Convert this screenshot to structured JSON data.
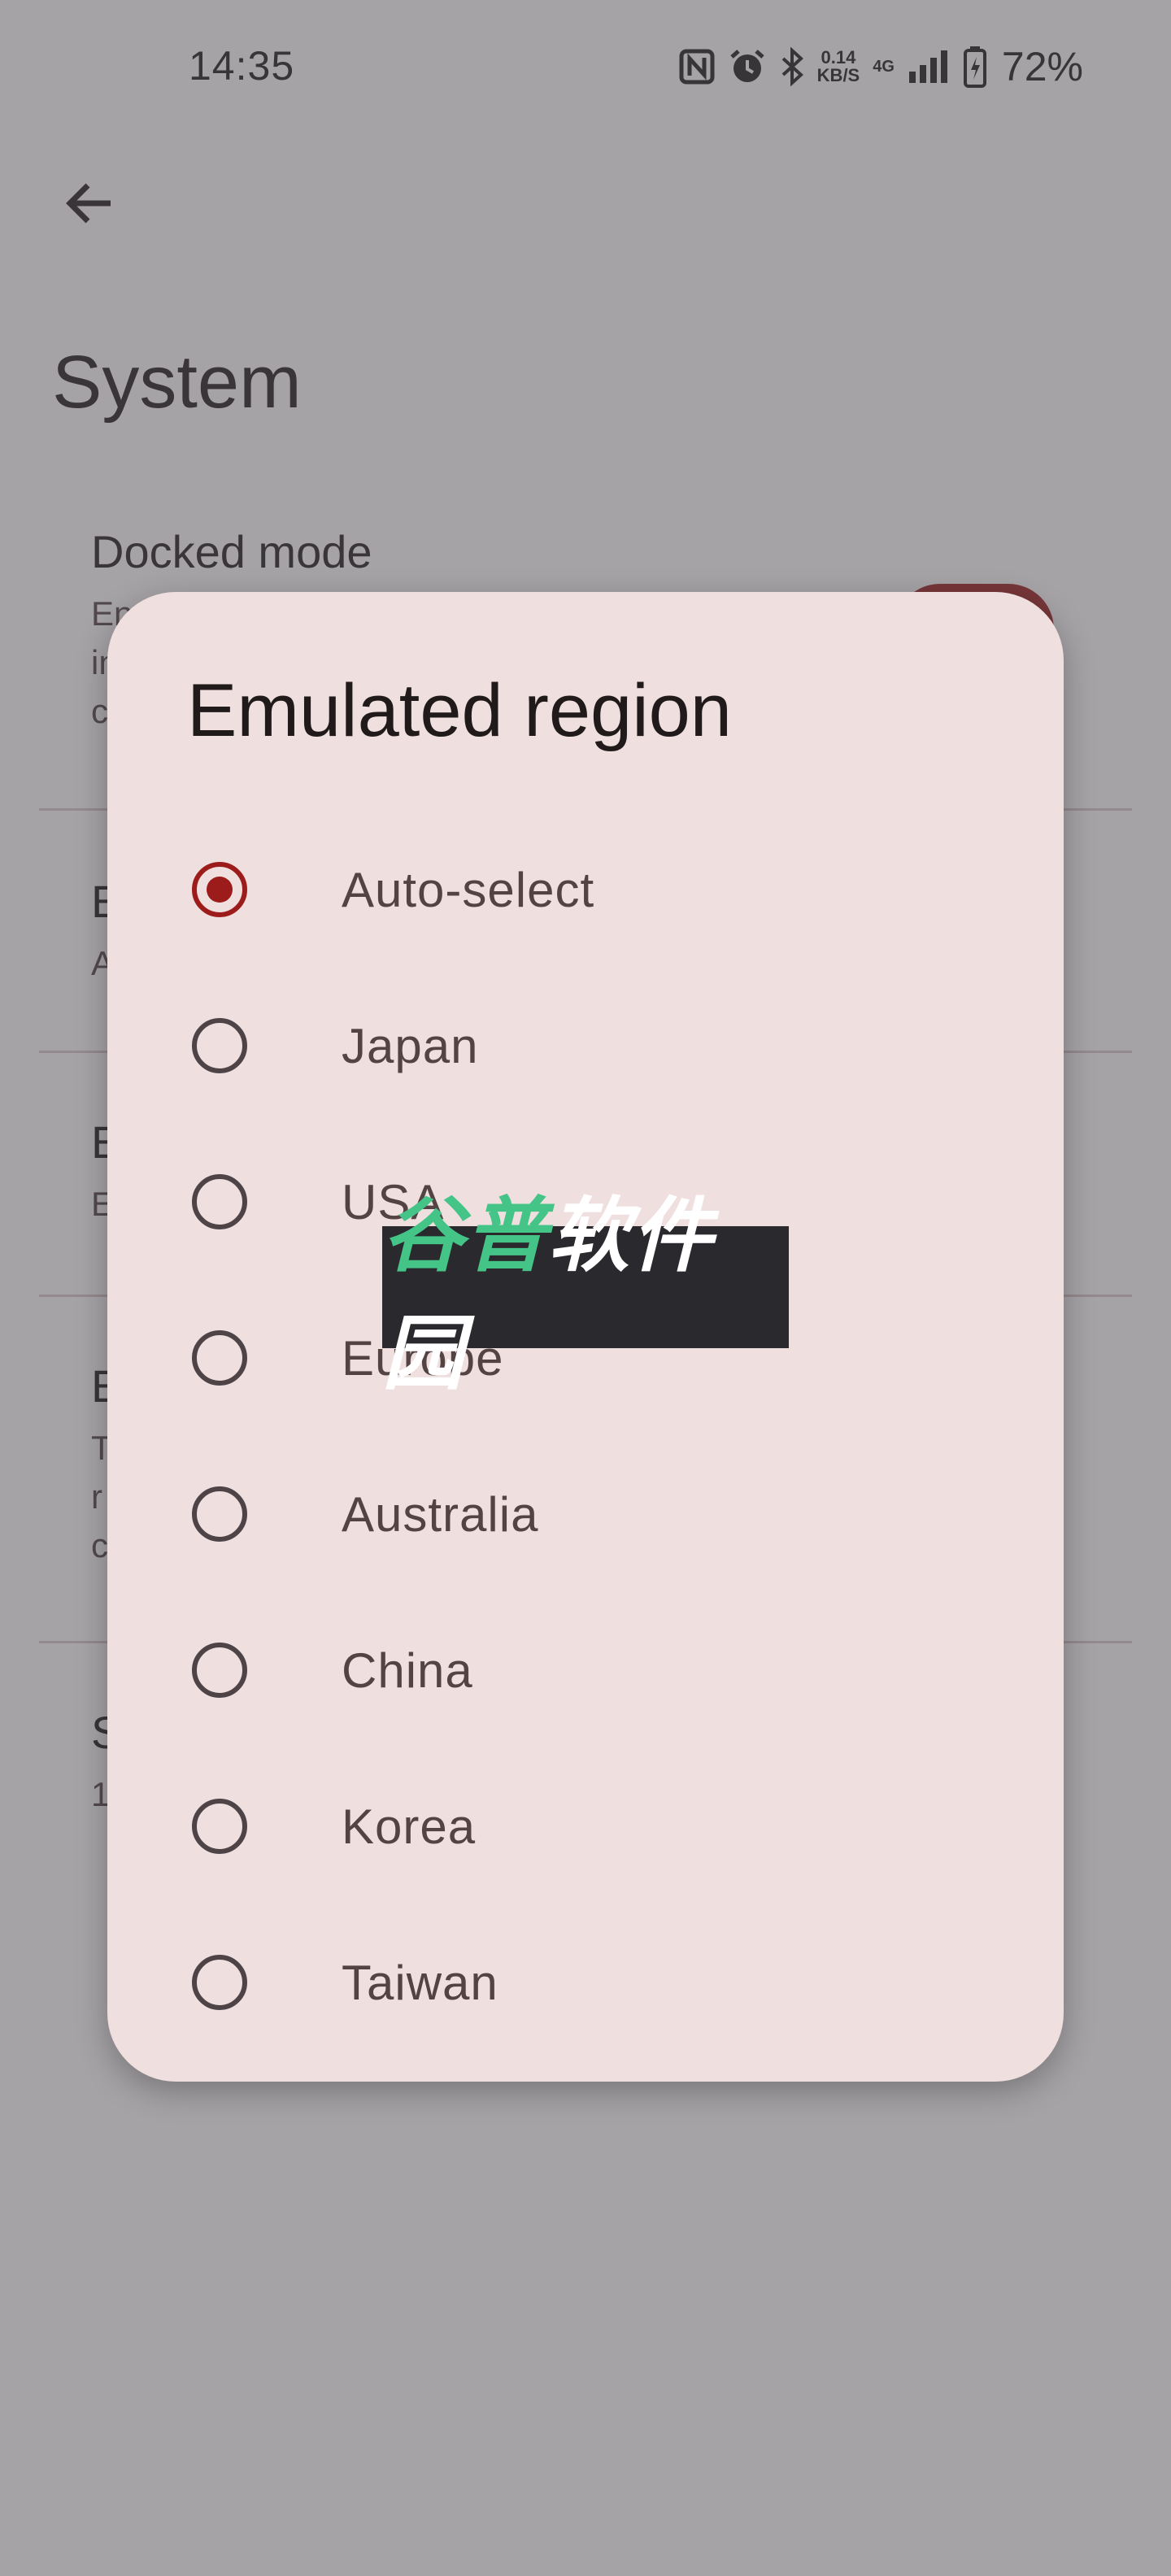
{
  "status_bar": {
    "time": "14:35",
    "net_speed_value": "0.14",
    "net_speed_unit": "KB/S",
    "network": "4G",
    "battery": "72%",
    "icons": [
      "nfc-icon",
      "alarm-icon",
      "bluetooth-icon",
      "signal-icon",
      "battery-icon"
    ]
  },
  "page": {
    "title": "System"
  },
  "settings": {
    "docked_mode": {
      "title": "Docked mode",
      "summary_line1": "En",
      "summary_line2": "in",
      "summary_line3": "c"
    },
    "item2": {
      "title": "E",
      "summary": "A"
    },
    "item3": {
      "title": "E",
      "summary": "E"
    },
    "item4": {
      "title": "E",
      "summary_line1": "T",
      "summary_line2": "r",
      "summary_line3": "c"
    },
    "item5": {
      "title": "S",
      "summary": "1"
    }
  },
  "dialog": {
    "title": "Emulated region",
    "selected": "Auto-select",
    "options": [
      {
        "label": "Auto-select"
      },
      {
        "label": "Japan"
      },
      {
        "label": "USA"
      },
      {
        "label": "Europe"
      },
      {
        "label": "Australia"
      },
      {
        "label": "China"
      },
      {
        "label": "Korea"
      },
      {
        "label": "Taiwan"
      }
    ]
  },
  "watermark": {
    "part1": "谷普",
    "part2": "软件园"
  },
  "colors": {
    "accent": "#9c1c1c",
    "dialog_surface": "#efdfdf",
    "scrim": "#525056"
  }
}
